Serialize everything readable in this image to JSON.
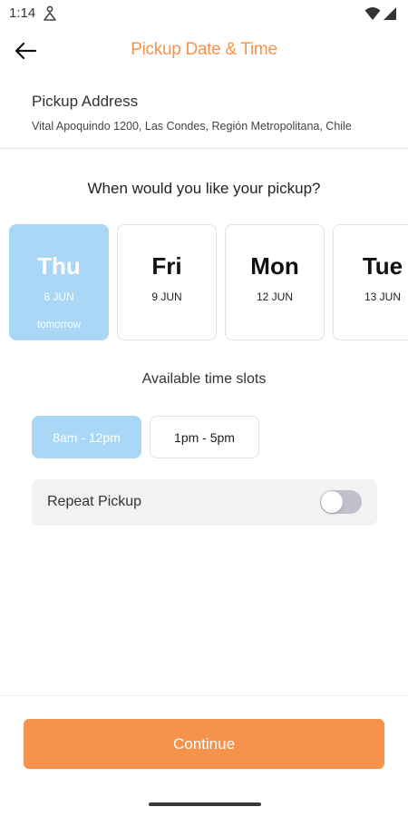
{
  "status_bar": {
    "time": "1:14",
    "icons": [
      "person-icon",
      "wifi-icon",
      "signal-icon"
    ]
  },
  "header": {
    "title": "Pickup Date & Time",
    "back_icon": "arrow-left-icon"
  },
  "address": {
    "label": "Pickup Address",
    "value": "Vital Apoquindo 1200, Las Condes, Región Metropolitana, Chile"
  },
  "question": "When would you like your pickup?",
  "days": [
    {
      "day": "Thu",
      "date": "8 JUN",
      "sub": "tomorrow",
      "selected": true
    },
    {
      "day": "Fri",
      "date": "9 JUN",
      "sub": "",
      "selected": false
    },
    {
      "day": "Mon",
      "date": "12 JUN",
      "sub": "",
      "selected": false
    },
    {
      "day": "Tue",
      "date": "13 JUN",
      "sub": "",
      "selected": false
    }
  ],
  "slots_heading": "Available time slots",
  "slots": [
    {
      "label": "8am - 12pm",
      "selected": true
    },
    {
      "label": "1pm - 5pm",
      "selected": false
    }
  ],
  "repeat": {
    "label": "Repeat Pickup",
    "enabled": false
  },
  "continue_label": "Continue",
  "colors": {
    "accent": "#f6924c",
    "selected": "#a9d7f5",
    "toggle_off": "#bfc0cc"
  }
}
